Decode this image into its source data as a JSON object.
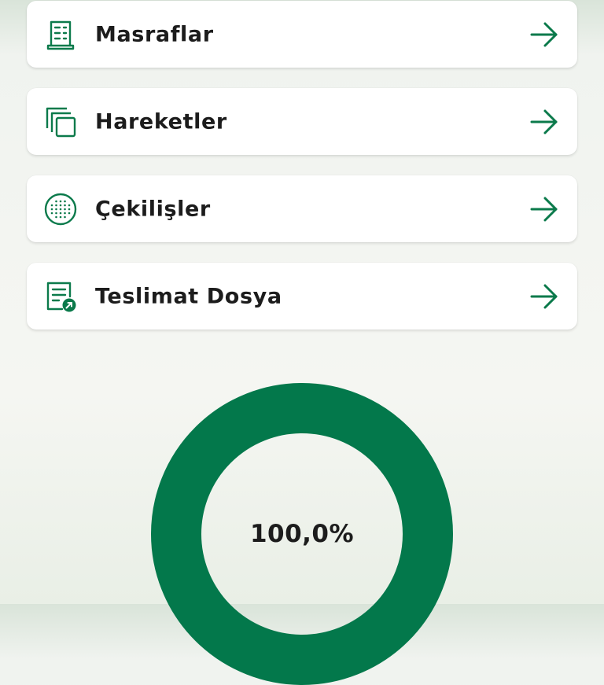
{
  "theme": {
    "accent": "#0b7a4b",
    "donut_fill": "#03784b",
    "text": "#1c1c1c",
    "card_bg": "#ffffff"
  },
  "menu": {
    "items": [
      {
        "label": "Masraflar",
        "icon": "receipt-icon"
      },
      {
        "label": "Hareketler",
        "icon": "copy-icon"
      },
      {
        "label": "Çekilişler",
        "icon": "dotted-circle-icon"
      },
      {
        "label": "Teslimat Dosya",
        "icon": "document-shared-icon"
      }
    ]
  },
  "chart_data": {
    "type": "pie",
    "categories": [
      ""
    ],
    "values": [
      100.0
    ],
    "center_label": "100,0%"
  }
}
